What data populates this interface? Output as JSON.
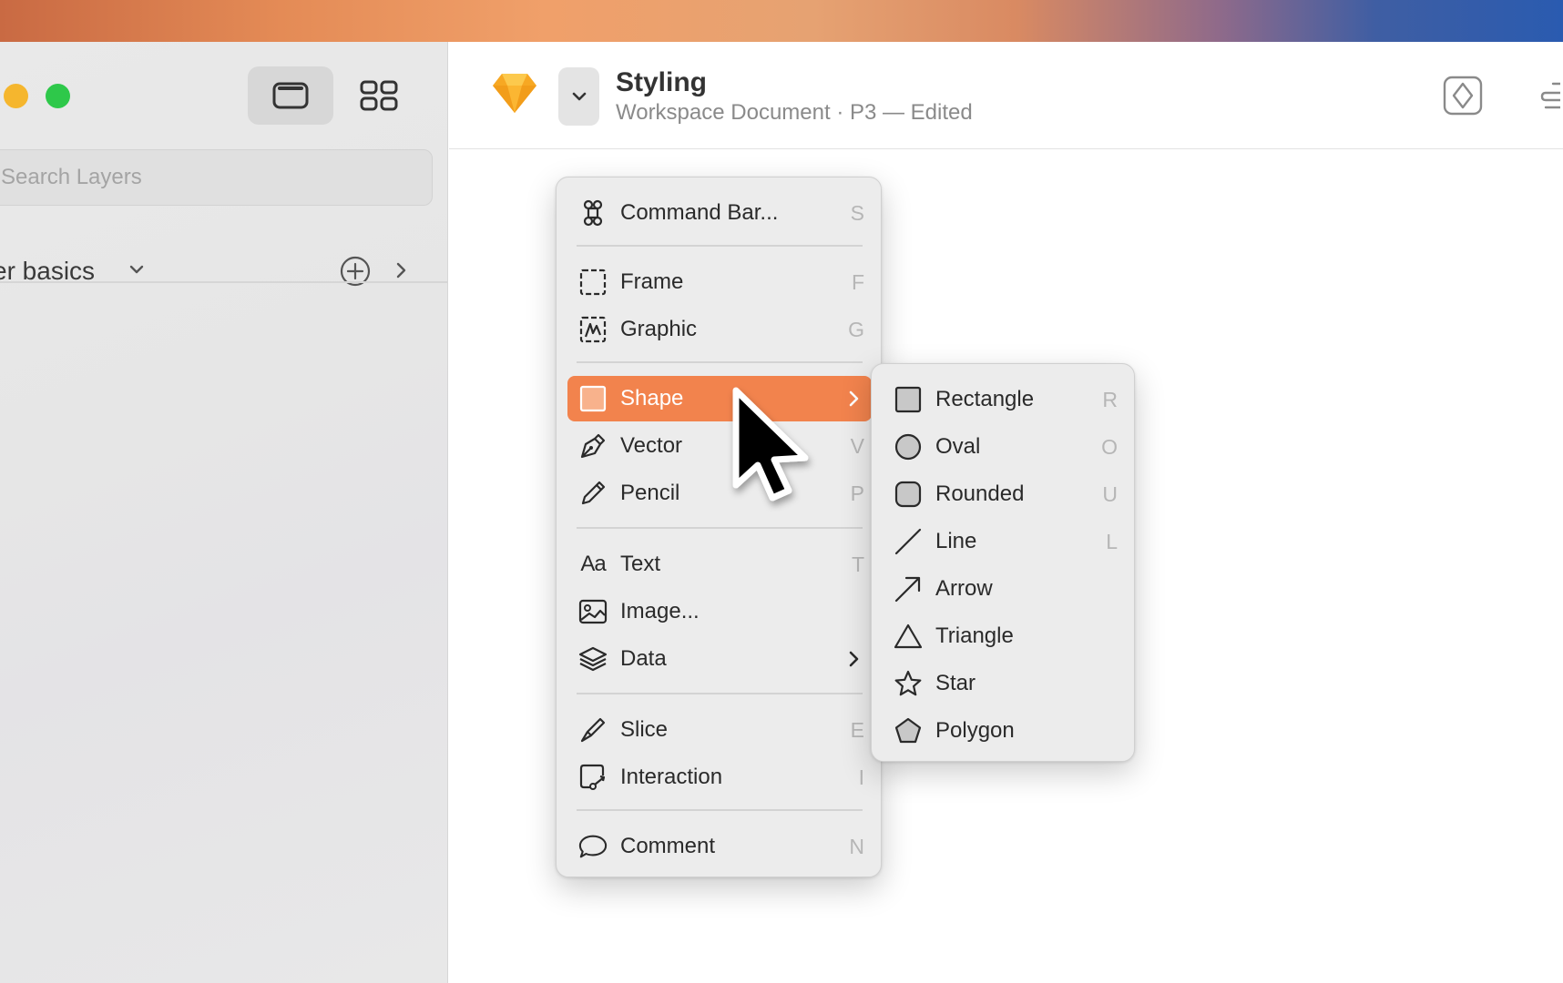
{
  "window": {
    "search_placeholder": "Search Layers",
    "page_name": "er basics"
  },
  "toolbar": {
    "title": "Styling",
    "subtitle": "Workspace Document · P3 — Edited"
  },
  "insert_menu": {
    "items": [
      {
        "label": "Command Bar...",
        "shortcut": "S",
        "icon": "command-icon"
      },
      {
        "label": "Frame",
        "shortcut": "F",
        "icon": "frame-icon"
      },
      {
        "label": "Graphic",
        "shortcut": "G",
        "icon": "graphic-icon"
      },
      {
        "label": "Shape",
        "shortcut": "",
        "icon": "shape-icon",
        "has_submenu": true,
        "selected": true
      },
      {
        "label": "Vector",
        "shortcut": "V",
        "icon": "pen-icon"
      },
      {
        "label": "Pencil",
        "shortcut": "P",
        "icon": "pencil-icon"
      },
      {
        "label": "Text",
        "shortcut": "T",
        "icon": "text-icon",
        "glyph": "Aa"
      },
      {
        "label": "Image...",
        "shortcut": "",
        "icon": "image-icon"
      },
      {
        "label": "Data",
        "shortcut": "",
        "icon": "layers-stack-icon",
        "has_submenu": true
      },
      {
        "label": "Slice",
        "shortcut": "E",
        "icon": "slice-knife-icon"
      },
      {
        "label": "Interaction",
        "shortcut": "I",
        "icon": "interaction-icon"
      },
      {
        "label": "Comment",
        "shortcut": "N",
        "icon": "comment-bubble-icon"
      }
    ]
  },
  "shape_submenu": {
    "items": [
      {
        "label": "Rectangle",
        "shortcut": "R",
        "icon": "rectangle-icon"
      },
      {
        "label": "Oval",
        "shortcut": "O",
        "icon": "oval-icon"
      },
      {
        "label": "Rounded",
        "shortcut": "U",
        "icon": "rounded-rect-icon"
      },
      {
        "label": "Line",
        "shortcut": "L",
        "icon": "line-icon"
      },
      {
        "label": "Arrow",
        "shortcut": "",
        "icon": "arrow-icon"
      },
      {
        "label": "Triangle",
        "shortcut": "",
        "icon": "triangle-icon"
      },
      {
        "label": "Star",
        "shortcut": "",
        "icon": "star-icon"
      },
      {
        "label": "Polygon",
        "shortcut": "",
        "icon": "polygon-icon"
      }
    ]
  },
  "colors": {
    "accent_highlight": "#f2834d",
    "traffic_yellow": "#f5b62e",
    "traffic_green": "#2ec84a",
    "logo": "#f7a823"
  }
}
